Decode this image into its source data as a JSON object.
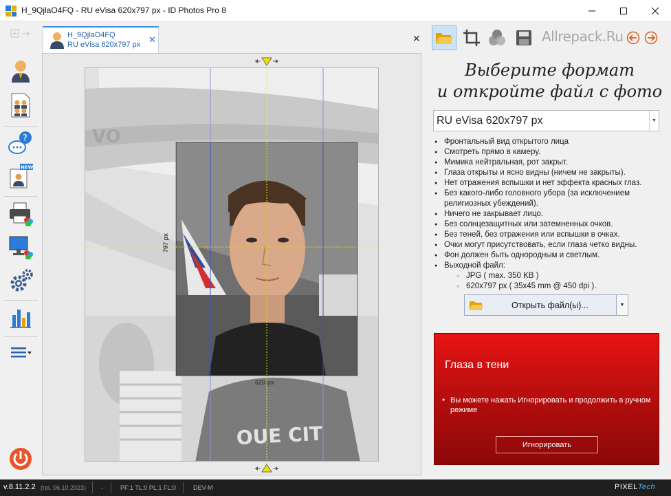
{
  "window": {
    "title": "H_9QjlaO4FQ - RU eVisa 620x797 px - ID Photos Pro 8"
  },
  "tab": {
    "line1": "H_9QjlaO4FQ",
    "line2": "RU eVisa 620x797 px",
    "close": "✕"
  },
  "canvas": {
    "pane_close": "✕",
    "height_label": "797 px",
    "width_label": "620 px",
    "photo_text": "VO"
  },
  "right_panel": {
    "watermark": "Allrepack.Ru",
    "heading_line1": "Выберите формат",
    "heading_line2": "и откройте файл с фото",
    "format": "RU eVisa 620x797 px",
    "requirements": [
      "Фронтальный вид открытого лица",
      "Смотреть прямо в камеру.",
      "Мимика нейтральная, рот закрыт.",
      "Глаза открыты и ясно видны (ничем не закрыты).",
      "Нет отражения вспышки и нет эффекта красных глаз.",
      "Без какого-либо головного убора (за исключением религиозных убеждений).",
      "Ничего не закрывает лицо.",
      "Без солнцезащитных или затемненных очков.",
      "Без теней, без отражения или вспышки в очках.",
      "Очки могут присутствовать, если глаза четко видны.",
      "Фон должен быть однородным и светлым.",
      "Выходной файл:"
    ],
    "output": [
      "JPG  ( max. 350 KB )",
      "620x797 px  ( 35x45 mm @ 450 dpi )."
    ],
    "open_button": "Открыть файл(ы)...",
    "alert": {
      "title": "Глаза в тени",
      "message": "Вы можете нажать Игнорировать и продолжить в ручном режиме",
      "ignore_button": "Игнорировать"
    }
  },
  "status": {
    "version": "v.8.11.2.2",
    "release": "(rel. 06.10.2023)",
    "dot": ".",
    "flags": "PF:1 TL:0 PL:1 FL:0",
    "mode": "DEV-M",
    "brand_a": "PIXEL",
    "brand_b": "Tech"
  },
  "colors": {
    "accent": "#3c8ee8",
    "alert_red": "#d81010",
    "guide_blue": "#3c50c8",
    "guide_yellow": "#e8e000"
  }
}
